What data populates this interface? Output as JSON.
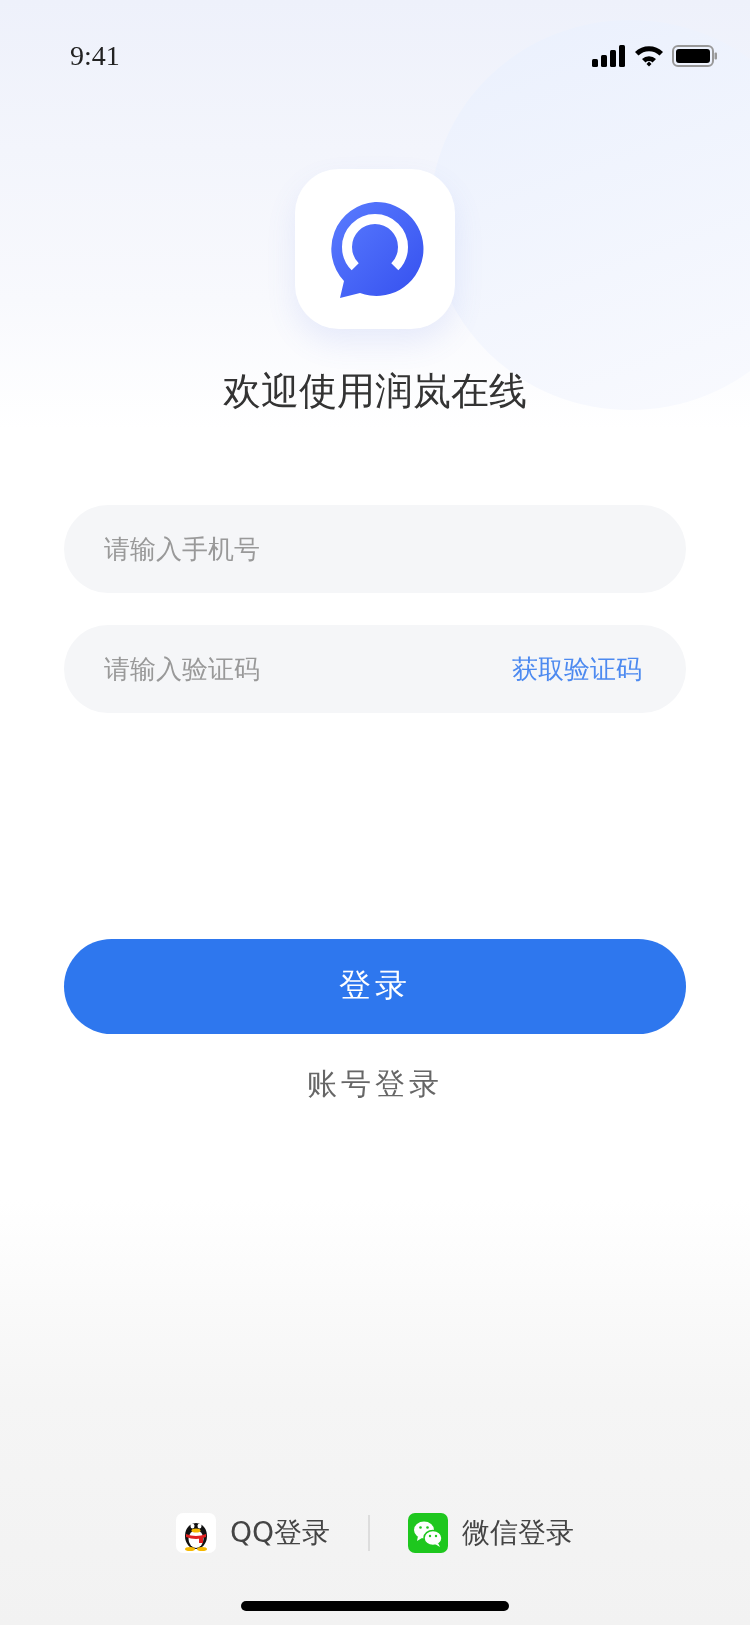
{
  "status_bar": {
    "time": "9:41"
  },
  "title": "欢迎使用润岚在线",
  "fields": [
    {
      "placeholder": "请输入手机号"
    },
    {
      "placeholder": "请输入验证码",
      "action": "获取验证码"
    }
  ],
  "login_button": "登录",
  "account_login": "账号登录",
  "third_party": [
    {
      "kind": "qq",
      "label": "QQ登录"
    },
    {
      "kind": "wechat",
      "label": "微信登录"
    }
  ]
}
